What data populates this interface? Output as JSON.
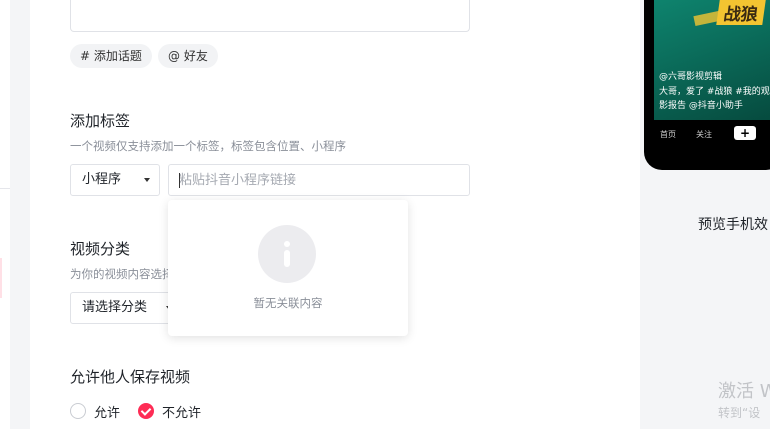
{
  "chips": {
    "topic": "# 添加话题",
    "friend": "@ 好友"
  },
  "tag_section": {
    "title": "添加标签",
    "desc": "一个视频仅支持添加一个标签，标签包含位置、小程序",
    "type_select": "小程序",
    "link_placeholder": "粘贴抖音小程序链接",
    "dropdown_empty_text": "暂无关联内容",
    "dropdown_icon": "info-icon"
  },
  "category_section": {
    "title": "视频分类",
    "desc": "为你的视频内容选择",
    "select_placeholder": "请选择分类"
  },
  "save_section": {
    "title": "允许他人保存视频",
    "options": [
      {
        "label": "允许",
        "checked": false
      },
      {
        "label": "不允许",
        "checked": true
      }
    ]
  },
  "phone_preview": {
    "poster_title": "战狼",
    "caption_user": "@六哥影视剪辑",
    "caption_line1": "大哥，爱了 #战狼 #我的观",
    "caption_line2": "影报告 @抖音小助手",
    "nav": {
      "home": "首页",
      "follow": "关注",
      "plus": "+"
    }
  },
  "preview_label": "预览手机效",
  "watermark": {
    "title": "激活 W",
    "subtitle": "转到“设"
  },
  "colors": {
    "accent": "#fe2c55",
    "poster": "#f3c431",
    "phone_bg": "#0c7a66"
  }
}
